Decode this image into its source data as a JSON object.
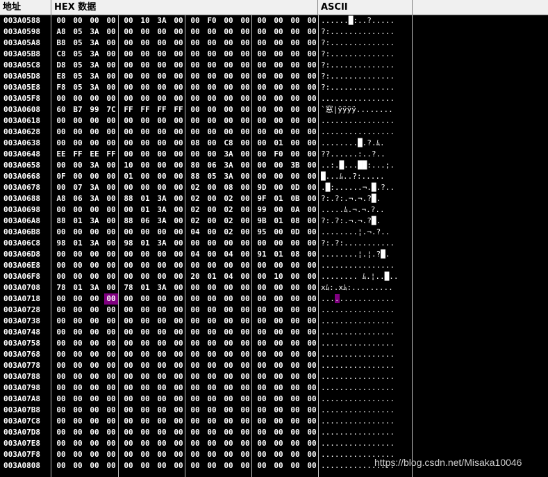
{
  "header": {
    "address_label": "地址",
    "hex_label": "HEX 数据",
    "ascii_label": "ASCII"
  },
  "selected": {
    "row": 21,
    "byte": 3
  },
  "rows": [
    {
      "addr": "003A0588",
      "bytes": [
        "00",
        "00",
        "00",
        "00",
        "00",
        "10",
        "3A",
        "00",
        "00",
        "F0",
        "00",
        "00",
        "00",
        "00",
        "00",
        "00"
      ],
      "ascii": "......█:..?....."
    },
    {
      "addr": "003A0598",
      "bytes": [
        "A8",
        "05",
        "3A",
        "00",
        "00",
        "00",
        "00",
        "00",
        "00",
        "00",
        "00",
        "00",
        "00",
        "00",
        "00",
        "00"
      ],
      "ascii": "?:.............."
    },
    {
      "addr": "003A05A8",
      "bytes": [
        "B8",
        "05",
        "3A",
        "00",
        "00",
        "00",
        "00",
        "00",
        "00",
        "00",
        "00",
        "00",
        "00",
        "00",
        "00",
        "00"
      ],
      "ascii": "?:.............."
    },
    {
      "addr": "003A05B8",
      "bytes": [
        "C8",
        "05",
        "3A",
        "00",
        "00",
        "00",
        "00",
        "00",
        "00",
        "00",
        "00",
        "00",
        "00",
        "00",
        "00",
        "00"
      ],
      "ascii": "?:.............."
    },
    {
      "addr": "003A05C8",
      "bytes": [
        "D8",
        "05",
        "3A",
        "00",
        "00",
        "00",
        "00",
        "00",
        "00",
        "00",
        "00",
        "00",
        "00",
        "00",
        "00",
        "00"
      ],
      "ascii": "?:.............."
    },
    {
      "addr": "003A05D8",
      "bytes": [
        "E8",
        "05",
        "3A",
        "00",
        "00",
        "00",
        "00",
        "00",
        "00",
        "00",
        "00",
        "00",
        "00",
        "00",
        "00",
        "00"
      ],
      "ascii": "?:.............."
    },
    {
      "addr": "003A05E8",
      "bytes": [
        "F8",
        "05",
        "3A",
        "00",
        "00",
        "00",
        "00",
        "00",
        "00",
        "00",
        "00",
        "00",
        "00",
        "00",
        "00",
        "00"
      ],
      "ascii": "?:.............."
    },
    {
      "addr": "003A05F8",
      "bytes": [
        "00",
        "00",
        "00",
        "00",
        "00",
        "00",
        "00",
        "00",
        "00",
        "00",
        "00",
        "00",
        "00",
        "00",
        "00",
        "00"
      ],
      "ascii": "................"
    },
    {
      "addr": "003A0608",
      "bytes": [
        "60",
        "B7",
        "99",
        "7C",
        "FF",
        "FF",
        "FF",
        "FF",
        "00",
        "00",
        "00",
        "00",
        "00",
        "00",
        "00",
        "00"
      ],
      "ascii": "`窓|ÿÿÿÿ........"
    },
    {
      "addr": "003A0618",
      "bytes": [
        "00",
        "00",
        "00",
        "00",
        "00",
        "00",
        "00",
        "00",
        "00",
        "00",
        "00",
        "00",
        "00",
        "00",
        "00",
        "00"
      ],
      "ascii": "................"
    },
    {
      "addr": "003A0628",
      "bytes": [
        "00",
        "00",
        "00",
        "00",
        "00",
        "00",
        "00",
        "00",
        "00",
        "00",
        "00",
        "00",
        "00",
        "00",
        "00",
        "00"
      ],
      "ascii": "................"
    },
    {
      "addr": "003A0638",
      "bytes": [
        "00",
        "00",
        "00",
        "00",
        "00",
        "00",
        "00",
        "00",
        "08",
        "00",
        "C8",
        "00",
        "00",
        "01",
        "00",
        "00"
      ],
      "ascii": "........█.?.ﾑ."
    },
    {
      "addr": "003A0648",
      "bytes": [
        "EE",
        "FF",
        "EE",
        "FF",
        "00",
        "00",
        "00",
        "00",
        "00",
        "00",
        "3A",
        "00",
        "00",
        "F0",
        "00",
        "00"
      ],
      "ascii": "??......:..?.."
    },
    {
      "addr": "003A0658",
      "bytes": [
        "00",
        "00",
        "3A",
        "00",
        "10",
        "00",
        "00",
        "00",
        "80",
        "06",
        "3A",
        "00",
        "00",
        "00",
        "3B",
        "00"
      ],
      "ascii": "..:.█...██:...;."
    },
    {
      "addr": "003A0668",
      "bytes": [
        "0F",
        "00",
        "00",
        "00",
        "01",
        "00",
        "00",
        "00",
        "88",
        "05",
        "3A",
        "00",
        "00",
        "00",
        "00",
        "00"
      ],
      "ascii": "█...ﾑ..?:....."
    },
    {
      "addr": "003A0678",
      "bytes": [
        "00",
        "07",
        "3A",
        "00",
        "00",
        "00",
        "00",
        "00",
        "02",
        "00",
        "08",
        "00",
        "9D",
        "00",
        "0D",
        "00"
      ],
      "ascii": ".█:......¬.█.?.."
    },
    {
      "addr": "003A0688",
      "bytes": [
        "A8",
        "06",
        "3A",
        "00",
        "88",
        "01",
        "3A",
        "00",
        "02",
        "00",
        "02",
        "00",
        "9F",
        "01",
        "0B",
        "00"
      ],
      "ascii": "?:.?:.¬.¬.?█."
    },
    {
      "addr": "003A0698",
      "bytes": [
        "00",
        "00",
        "00",
        "00",
        "00",
        "01",
        "3A",
        "00",
        "02",
        "00",
        "02",
        "00",
        "99",
        "00",
        "0A",
        "00"
      ],
      "ascii": ".....ﾑ.¬.¬.?.."
    },
    {
      "addr": "003A06A8",
      "bytes": [
        "88",
        "01",
        "3A",
        "00",
        "88",
        "06",
        "3A",
        "00",
        "02",
        "00",
        "02",
        "00",
        "9B",
        "01",
        "08",
        "00"
      ],
      "ascii": "?:.?:.¬.¬.?█."
    },
    {
      "addr": "003A06B8",
      "bytes": [
        "00",
        "00",
        "00",
        "00",
        "00",
        "00",
        "00",
        "00",
        "04",
        "00",
        "02",
        "00",
        "95",
        "00",
        "0D",
        "00"
      ],
      "ascii": "........¦.¬.?.."
    },
    {
      "addr": "003A06C8",
      "bytes": [
        "98",
        "01",
        "3A",
        "00",
        "98",
        "01",
        "3A",
        "00",
        "00",
        "00",
        "00",
        "00",
        "00",
        "00",
        "00",
        "00"
      ],
      "ascii": "?:.?:..........."
    },
    {
      "addr": "003A0718",
      "bytes": [
        "00",
        "00",
        "00",
        "00",
        "00",
        "00",
        "00",
        "00",
        "00",
        "00",
        "00",
        "00",
        "00",
        "00",
        "00",
        "00"
      ],
      "ascii": "................"
    }
  ],
  "rows_b": [
    {
      "addr": "003A06D8",
      "bytes": [
        "00",
        "00",
        "00",
        "00",
        "00",
        "00",
        "00",
        "00",
        "04",
        "00",
        "04",
        "00",
        "91",
        "01",
        "08",
        "00"
      ],
      "ascii": "........¦.¦.?█."
    },
    {
      "addr": "003A06E8",
      "bytes": [
        "00",
        "00",
        "00",
        "00",
        "00",
        "00",
        "00",
        "00",
        "00",
        "00",
        "00",
        "00",
        "00",
        "00",
        "00",
        "00"
      ],
      "ascii": "................"
    },
    {
      "addr": "003A06F8",
      "bytes": [
        "00",
        "00",
        "00",
        "00",
        "00",
        "00",
        "00",
        "00",
        "20",
        "01",
        "04",
        "00",
        "00",
        "10",
        "00",
        "00"
      ],
      "ascii": "........ ﾑ.¦..█.."
    },
    {
      "addr": "003A0708",
      "bytes": [
        "78",
        "01",
        "3A",
        "00",
        "78",
        "01",
        "3A",
        "00",
        "00",
        "00",
        "00",
        "00",
        "00",
        "00",
        "00",
        "00"
      ],
      "ascii": "xﾑ:.xﾑ:........."
    },
    {
      "addr": "003A0718",
      "bytes": [
        "00",
        "00",
        "00",
        "00",
        "00",
        "00",
        "00",
        "00",
        "00",
        "00",
        "00",
        "00",
        "00",
        "00",
        "00",
        "00"
      ],
      "ascii": "................"
    },
    {
      "addr": "003A0728",
      "bytes": [
        "00",
        "00",
        "00",
        "00",
        "00",
        "00",
        "00",
        "00",
        "00",
        "00",
        "00",
        "00",
        "00",
        "00",
        "00",
        "00"
      ],
      "ascii": "................"
    },
    {
      "addr": "003A0738",
      "bytes": [
        "00",
        "00",
        "00",
        "00",
        "00",
        "00",
        "00",
        "00",
        "00",
        "00",
        "00",
        "00",
        "00",
        "00",
        "00",
        "00"
      ],
      "ascii": "................"
    },
    {
      "addr": "003A0748",
      "bytes": [
        "00",
        "00",
        "00",
        "00",
        "00",
        "00",
        "00",
        "00",
        "00",
        "00",
        "00",
        "00",
        "00",
        "00",
        "00",
        "00"
      ],
      "ascii": "................"
    },
    {
      "addr": "003A0758",
      "bytes": [
        "00",
        "00",
        "00",
        "00",
        "00",
        "00",
        "00",
        "00",
        "00",
        "00",
        "00",
        "00",
        "00",
        "00",
        "00",
        "00"
      ],
      "ascii": "................"
    },
    {
      "addr": "003A0768",
      "bytes": [
        "00",
        "00",
        "00",
        "00",
        "00",
        "00",
        "00",
        "00",
        "00",
        "00",
        "00",
        "00",
        "00",
        "00",
        "00",
        "00"
      ],
      "ascii": "................"
    },
    {
      "addr": "003A0778",
      "bytes": [
        "00",
        "00",
        "00",
        "00",
        "00",
        "00",
        "00",
        "00",
        "00",
        "00",
        "00",
        "00",
        "00",
        "00",
        "00",
        "00"
      ],
      "ascii": "................"
    },
    {
      "addr": "003A0788",
      "bytes": [
        "00",
        "00",
        "00",
        "00",
        "00",
        "00",
        "00",
        "00",
        "00",
        "00",
        "00",
        "00",
        "00",
        "00",
        "00",
        "00"
      ],
      "ascii": "................"
    },
    {
      "addr": "003A0798",
      "bytes": [
        "00",
        "00",
        "00",
        "00",
        "00",
        "00",
        "00",
        "00",
        "00",
        "00",
        "00",
        "00",
        "00",
        "00",
        "00",
        "00"
      ],
      "ascii": "................"
    },
    {
      "addr": "003A07A8",
      "bytes": [
        "00",
        "00",
        "00",
        "00",
        "00",
        "00",
        "00",
        "00",
        "00",
        "00",
        "00",
        "00",
        "00",
        "00",
        "00",
        "00"
      ],
      "ascii": "................"
    },
    {
      "addr": "003A07B8",
      "bytes": [
        "00",
        "00",
        "00",
        "00",
        "00",
        "00",
        "00",
        "00",
        "00",
        "00",
        "00",
        "00",
        "00",
        "00",
        "00",
        "00"
      ],
      "ascii": "................"
    },
    {
      "addr": "003A07C8",
      "bytes": [
        "00",
        "00",
        "00",
        "00",
        "00",
        "00",
        "00",
        "00",
        "00",
        "00",
        "00",
        "00",
        "00",
        "00",
        "00",
        "00"
      ],
      "ascii": "................"
    },
    {
      "addr": "003A07D8",
      "bytes": [
        "00",
        "00",
        "00",
        "00",
        "00",
        "00",
        "00",
        "00",
        "00",
        "00",
        "00",
        "00",
        "00",
        "00",
        "00",
        "00"
      ],
      "ascii": "................"
    },
    {
      "addr": "003A07E8",
      "bytes": [
        "00",
        "00",
        "00",
        "00",
        "00",
        "00",
        "00",
        "00",
        "00",
        "00",
        "00",
        "00",
        "00",
        "00",
        "00",
        "00"
      ],
      "ascii": "................"
    },
    {
      "addr": "003A07F8",
      "bytes": [
        "00",
        "00",
        "00",
        "00",
        "00",
        "00",
        "00",
        "00",
        "00",
        "00",
        "00",
        "00",
        "00",
        "00",
        "00",
        "00"
      ],
      "ascii": "................"
    },
    {
      "addr": "003A0808",
      "bytes": [
        "00",
        "00",
        "00",
        "00",
        "00",
        "00",
        "00",
        "00",
        "00",
        "00",
        "00",
        "00",
        "00",
        "00",
        "00",
        "00"
      ],
      "ascii": "................"
    }
  ],
  "watermark": "https://blog.csdn.net/Misaka10046"
}
